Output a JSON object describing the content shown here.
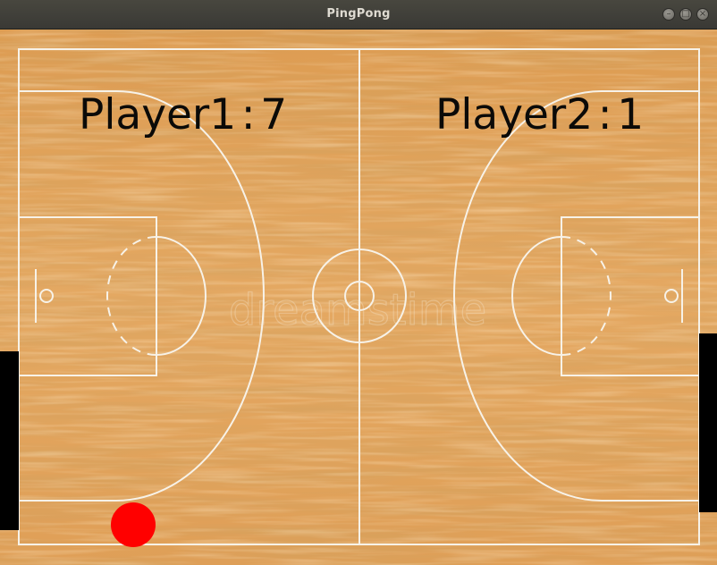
{
  "window": {
    "title": "PingPong"
  },
  "controls": {
    "minimize_glyph": "–",
    "maximize_glyph": "□",
    "close_glyph": "×"
  },
  "scoreboard": {
    "player1": {
      "label": "Player1",
      "separator": ":",
      "score": "7"
    },
    "player2": {
      "label": "Player2",
      "separator": ":",
      "score": "1"
    }
  },
  "colors": {
    "floor_base": "#e1a25a",
    "court_lines": "#f7f2e8",
    "paddles": "#000000",
    "ball": "#ff0000",
    "score_text": "#0b0a08"
  },
  "watermark": "dreamstime"
}
